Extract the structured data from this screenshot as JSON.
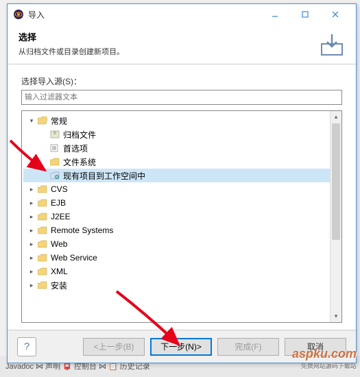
{
  "window": {
    "title": "导入"
  },
  "header": {
    "title": "选择",
    "subtitle": "从归档文件或目录创建新项目。"
  },
  "filter": {
    "label": "选择导入源(S)：",
    "placeholder": "输入过滤器文本"
  },
  "tree": {
    "root": {
      "label": "常规",
      "children": [
        {
          "label": "归档文件",
          "icon": "archive"
        },
        {
          "label": "首选项",
          "icon": "prefs"
        },
        {
          "label": "文件系统",
          "icon": "folder"
        },
        {
          "label": "现有项目到工作空间中",
          "icon": "project",
          "selected": true
        }
      ]
    },
    "siblings": [
      {
        "label": "CVS"
      },
      {
        "label": "EJB"
      },
      {
        "label": "J2EE"
      },
      {
        "label": "Remote Systems"
      },
      {
        "label": "Web"
      },
      {
        "label": "Web Service"
      },
      {
        "label": "XML"
      },
      {
        "label": "安装"
      }
    ]
  },
  "footer": {
    "back": "<上一步(B)",
    "next": "下一步(N)>",
    "finish": "完成(F)",
    "cancel": "取消"
  },
  "watermark": {
    "main": "aspku.com",
    "sub": "免费网站源码下载站"
  },
  "background_text": "Javadoc ⋈ 声明  📮 控制台 ⋈  📋 历史记录"
}
